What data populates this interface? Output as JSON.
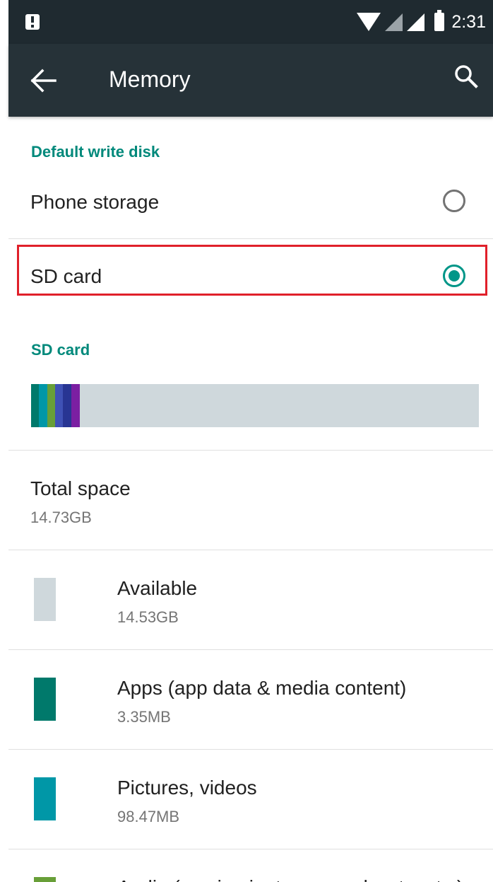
{
  "status_bar": {
    "time": "2:31"
  },
  "app_bar": {
    "title": "Memory"
  },
  "default_write_disk": {
    "header": "Default write disk",
    "options": [
      {
        "label": "Phone storage",
        "selected": false
      },
      {
        "label": "SD card",
        "selected": true
      }
    ]
  },
  "sd_card": {
    "header": "SD card",
    "total": {
      "label": "Total space",
      "value": "14.73GB"
    },
    "categories": [
      {
        "label": "Available",
        "value": "14.53GB",
        "color": "#cfd8dc"
      },
      {
        "label": "Apps (app data & media content)",
        "value": "3.35MB",
        "color": "#00796b"
      },
      {
        "label": "Pictures, videos",
        "value": "98.47MB",
        "color": "#0097a7"
      },
      {
        "label": "Audio (music, ringtones, podcasts, etc.)",
        "color": "#689f38"
      }
    ]
  },
  "colors": {
    "accent": "#009688",
    "appbar": "#263238",
    "statusbar": "#1f2a30",
    "highlight": "#e0202a"
  }
}
